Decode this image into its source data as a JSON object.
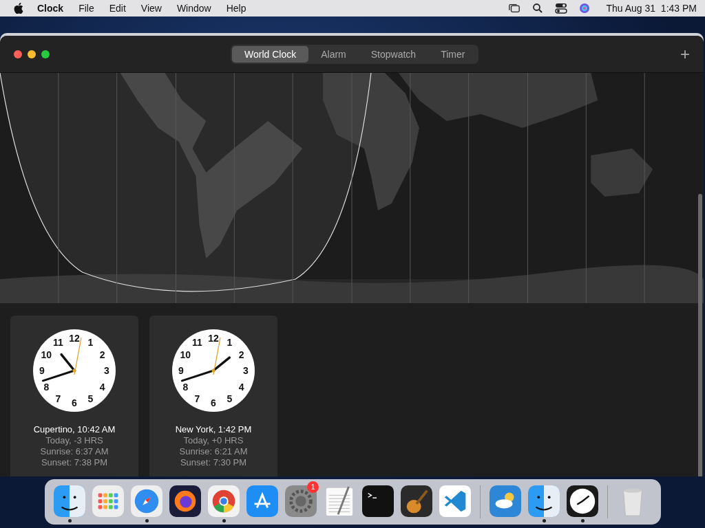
{
  "menu_bar": {
    "app_name": "Clock",
    "menus": [
      "File",
      "Edit",
      "View",
      "Window",
      "Help"
    ],
    "datetime": "Thu Aug 31  1:43 PM"
  },
  "tabs": [
    {
      "label": "World Clock",
      "selected": true
    },
    {
      "label": "Alarm",
      "selected": false
    },
    {
      "label": "Stopwatch",
      "selected": false
    },
    {
      "label": "Timer",
      "selected": false
    }
  ],
  "add_button": "+",
  "clocks": [
    {
      "dial_numbers": [
        "12",
        "11",
        "1",
        "10",
        "2",
        "9",
        "3",
        "8",
        "4",
        "7",
        "5",
        "6"
      ],
      "title": "Cupertino, 10:42 AM",
      "offset": "Today, -3 HRS",
      "sunrise": "Sunrise: 6:37 AM",
      "sunset": "Sunset: 7:38 PM"
    },
    {
      "dial_numbers": [
        "12",
        "11",
        "1",
        "10",
        "2",
        "9",
        "3",
        "8",
        "4",
        "7",
        "5",
        "6"
      ],
      "title": "New York, 1:42 PM",
      "offset": "Today, +0 HRS",
      "sunrise": "Sunrise: 6:21 AM",
      "sunset": "Sunset: 7:30 PM"
    }
  ],
  "dock": [
    {
      "kind": "finder",
      "running": true
    },
    {
      "kind": "launchpad",
      "running": false
    },
    {
      "kind": "safari",
      "running": true
    },
    {
      "kind": "firefox",
      "running": false
    },
    {
      "kind": "chrome",
      "running": true
    },
    {
      "kind": "appstore",
      "running": false
    },
    {
      "kind": "settings",
      "running": false,
      "badge": "1"
    },
    {
      "kind": "textedit",
      "running": false
    },
    {
      "kind": "terminal",
      "running": false
    },
    {
      "kind": "garageband",
      "running": false
    },
    {
      "kind": "vscode",
      "running": false
    },
    {
      "kind": "separator"
    },
    {
      "kind": "weather",
      "running": false
    },
    {
      "kind": "migration",
      "running": true
    },
    {
      "kind": "clock",
      "running": true
    },
    {
      "kind": "separator"
    },
    {
      "kind": "trash",
      "running": false
    }
  ]
}
